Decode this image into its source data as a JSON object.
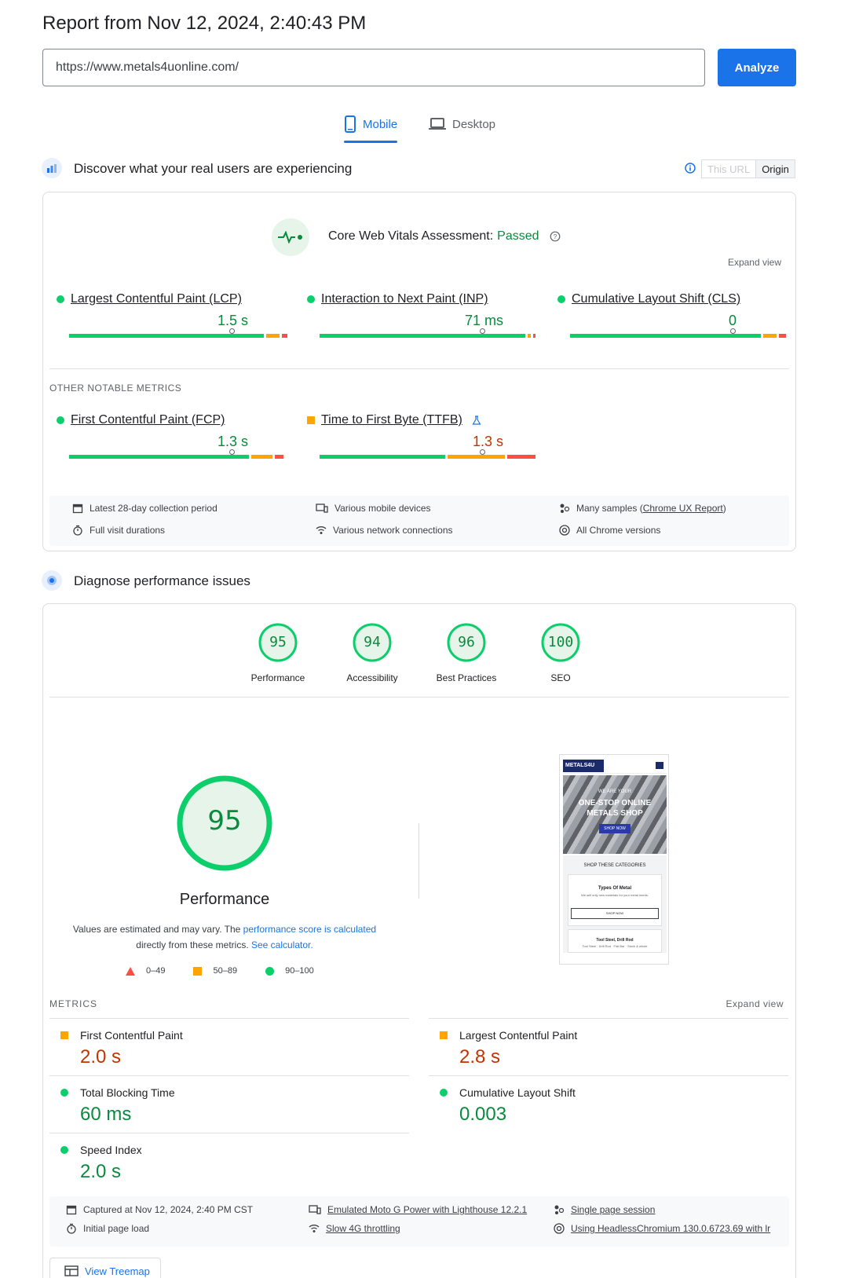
{
  "header": {
    "title": "Report from Nov 12, 2024, 2:40:43 PM",
    "url_value": "https://www.metals4uonline.com/",
    "analyze_label": "Analyze"
  },
  "tabs": [
    {
      "label": "Mobile",
      "active": true
    },
    {
      "label": "Desktop",
      "active": false
    }
  ],
  "field": {
    "heading": "Discover what your real users are experiencing",
    "toggle_url": "This URL",
    "toggle_origin": "Origin",
    "assessment_prefix": "Core Web Vitals Assessment:",
    "assessment_status": "Passed",
    "expand_view": "Expand view",
    "core_metrics": [
      {
        "name": "Largest Contentful Paint (LCP)",
        "value": "1.5 s",
        "status": "good"
      },
      {
        "name": "Interaction to Next Paint (INP)",
        "value": "71 ms",
        "status": "good"
      },
      {
        "name": "Cumulative Layout Shift (CLS)",
        "value": "0",
        "status": "good"
      }
    ],
    "other_heading": "OTHER NOTABLE METRICS",
    "other_metrics": [
      {
        "name": "First Contentful Paint (FCP)",
        "value": "1.3 s",
        "status": "good"
      },
      {
        "name": "Time to First Byte (TTFB)",
        "value": "1.3 s",
        "status": "average"
      }
    ],
    "meta": {
      "collection": "Latest 28-day collection period",
      "durations": "Full visit durations",
      "devices": "Various mobile devices",
      "network": "Various network connections",
      "samples_prefix": "Many samples (",
      "samples_link": "Chrome UX Report",
      "samples_suffix": ")",
      "chrome": "All Chrome versions"
    }
  },
  "lab": {
    "heading": "Diagnose performance issues",
    "scores": [
      {
        "label": "Performance",
        "value": "95"
      },
      {
        "label": "Accessibility",
        "value": "94"
      },
      {
        "label": "Best Practices",
        "value": "96"
      },
      {
        "label": "SEO",
        "value": "100"
      }
    ],
    "big_score": "95",
    "big_label": "Performance",
    "note_prefix": "Values are estimated and may vary. The ",
    "note_link": "performance score is calculated",
    "note_mid": "directly from these metrics. ",
    "note_link2": "See calculator.",
    "legend": [
      "0–49",
      "50–89",
      "90–100"
    ],
    "screenshot": {
      "brand": "METALS4U",
      "small": "WE ARE YOUR",
      "headline1": "ONE-STOP ONLINE",
      "headline2": "METALS SHOP",
      "shop_now": "SHOP NOW",
      "categories": "SHOP THESE CATEGORIES",
      "card_title": "Types Of Metal",
      "card_text": "We sell only new materials for your metal needs.",
      "card_button": "SHOP NOW",
      "card2_title": "Tool Steel, Drill Rod",
      "card2_text": "Tool Steel · Drill Rod · Flat Bar · Stock & whole"
    },
    "metrics_heading": "METRICS",
    "expand_view": "Expand view",
    "metrics": [
      {
        "name": "First Contentful Paint",
        "value": "2.0 s",
        "status": "average"
      },
      {
        "name": "Largest Contentful Paint",
        "value": "2.8 s",
        "status": "average"
      },
      {
        "name": "Total Blocking Time",
        "value": "60 ms",
        "status": "good"
      },
      {
        "name": "Cumulative Layout Shift",
        "value": "0.003",
        "status": "good"
      },
      {
        "name": "Speed Index",
        "value": "2.0 s",
        "status": "good"
      }
    ],
    "meta": {
      "captured": "Captured at Nov 12, 2024, 2:40 PM CST",
      "initial": "Initial page load",
      "emulated": "Emulated Moto G Power with Lighthouse 12.2.1",
      "throttling": "Slow 4G throttling",
      "session": "Single page session",
      "browser": "Using HeadlessChromium 130.0.6723.69 with lr"
    },
    "treemap": "View Treemap"
  },
  "colors": {
    "good": "#0cce6b",
    "average": "#ffa400",
    "poor": "#ff4e42",
    "accent": "#1a73e8"
  }
}
